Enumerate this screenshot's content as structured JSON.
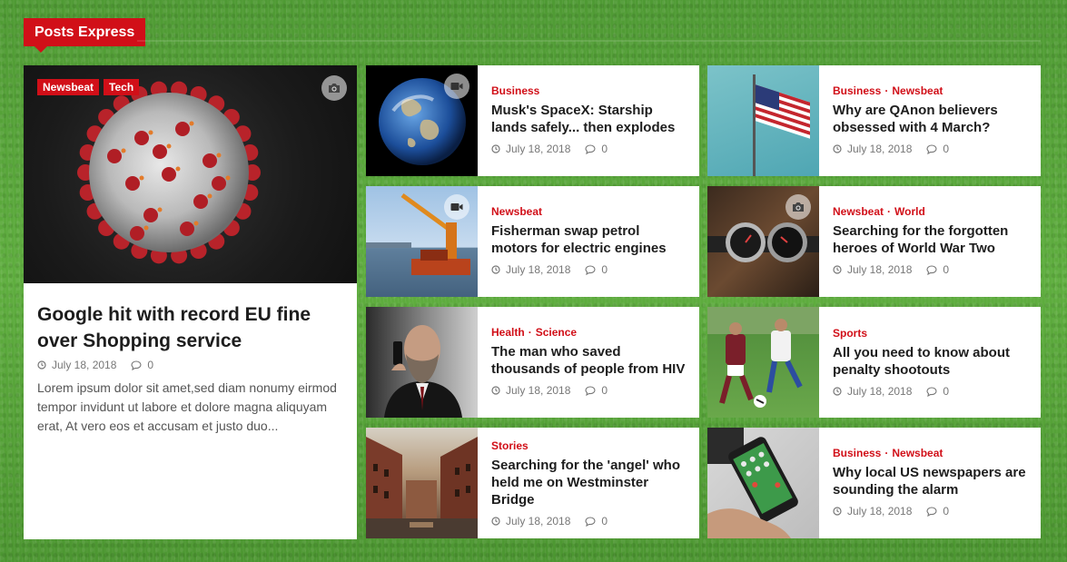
{
  "section": {
    "title": "Posts Express"
  },
  "featured": {
    "categories": [
      "Newsbeat",
      "Tech"
    ],
    "title": "Google hit with record EU fine over Shopping service",
    "date": "July 18, 2018",
    "comments": "0",
    "excerpt": "Lorem ipsum dolor sit amet,sed diam nonumy eirmod tempor invidunt ut labore et dolore magna aliquyam erat, At vero eos et accusam et justo duo...",
    "media_icon": "camera-icon"
  },
  "cards": [
    {
      "categories": [
        "Business"
      ],
      "title": "Musk's SpaceX: Starship lands safely... then explodes",
      "date": "July 18, 2018",
      "comments": "0",
      "media_icon": "video-icon"
    },
    {
      "categories": [
        "Business",
        "Newsbeat"
      ],
      "title": "Why are QAnon believers obsessed with 4 March?",
      "date": "July 18, 2018",
      "comments": "0"
    },
    {
      "categories": [
        "Newsbeat"
      ],
      "title": "Fisherman swap petrol motors for electric engines",
      "date": "July 18, 2018",
      "comments": "0",
      "media_icon": "video-icon"
    },
    {
      "categories": [
        "Newsbeat",
        "World"
      ],
      "title": "Searching for the forgotten heroes of World War Two",
      "date": "July 18, 2018",
      "comments": "0",
      "media_icon": "camera-icon"
    },
    {
      "categories": [
        "Health",
        "Science"
      ],
      "title": "The man who saved thousands of people from HIV",
      "date": "July 18, 2018",
      "comments": "0"
    },
    {
      "categories": [
        "Sports"
      ],
      "title": "All you need to know about penalty shootouts",
      "date": "July 18, 2018",
      "comments": "0"
    },
    {
      "categories": [
        "Stories"
      ],
      "title": "Searching for the 'angel' who held me on Westminster Bridge",
      "date": "July 18, 2018",
      "comments": "0"
    },
    {
      "categories": [
        "Business",
        "Newsbeat"
      ],
      "title": "Why local US newspapers are sounding the alarm",
      "date": "July 18, 2018",
      "comments": "0"
    }
  ],
  "colors": {
    "accent": "#d10f18",
    "background": "#56a23a"
  }
}
